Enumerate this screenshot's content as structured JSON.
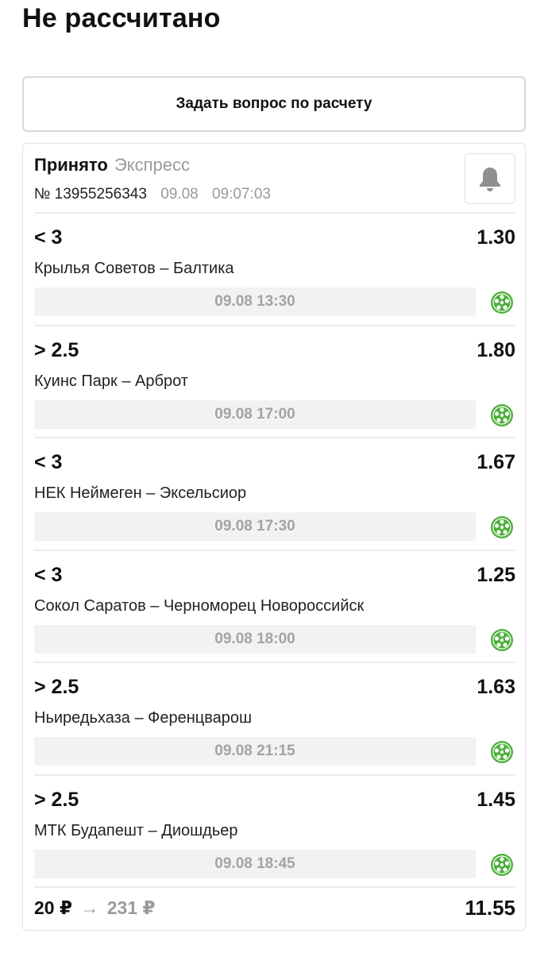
{
  "page": {
    "title": "Не рассчитано"
  },
  "ask_button": {
    "label": "Задать вопрос по расчету"
  },
  "bet": {
    "status": "Принято",
    "type": "Экспресс",
    "number": "№ 13955256343",
    "date": "09.08",
    "time": "09:07:03",
    "bell_icon": "bell-icon",
    "events": [
      {
        "outcome": "< 3",
        "odds": "1.30",
        "teams": "Крылья Советов – Балтика",
        "start": "09.08 13:30",
        "sport_icon": "football-icon"
      },
      {
        "outcome": "> 2.5",
        "odds": "1.80",
        "teams": "Куинс Парк – Арброт",
        "start": "09.08 17:00",
        "sport_icon": "football-icon"
      },
      {
        "outcome": "< 3",
        "odds": "1.67",
        "teams": "НЕК Неймеген – Эксельсиор",
        "start": "09.08 17:30",
        "sport_icon": "football-icon"
      },
      {
        "outcome": "< 3",
        "odds": "1.25",
        "teams": "Сокол Саратов – Черноморец Новороссийск",
        "start": "09.08 18:00",
        "sport_icon": "football-icon"
      },
      {
        "outcome": "> 2.5",
        "odds": "1.63",
        "teams": "Ньиредьхаза – Ференцварош",
        "start": "09.08 21:15",
        "sport_icon": "football-icon"
      },
      {
        "outcome": "> 2.5",
        "odds": "1.45",
        "teams": "МТК Будапешт – Диошдьер",
        "start": "09.08 18:45",
        "sport_icon": "football-icon"
      }
    ],
    "stake": "20 ₽",
    "arrow": "→",
    "payout": "231 ₽",
    "total_odds": "11.55"
  },
  "colors": {
    "accent_green": "#4caf3a",
    "muted_text": "#9a9a9a",
    "time_bar_bg": "#f2f2f2"
  }
}
